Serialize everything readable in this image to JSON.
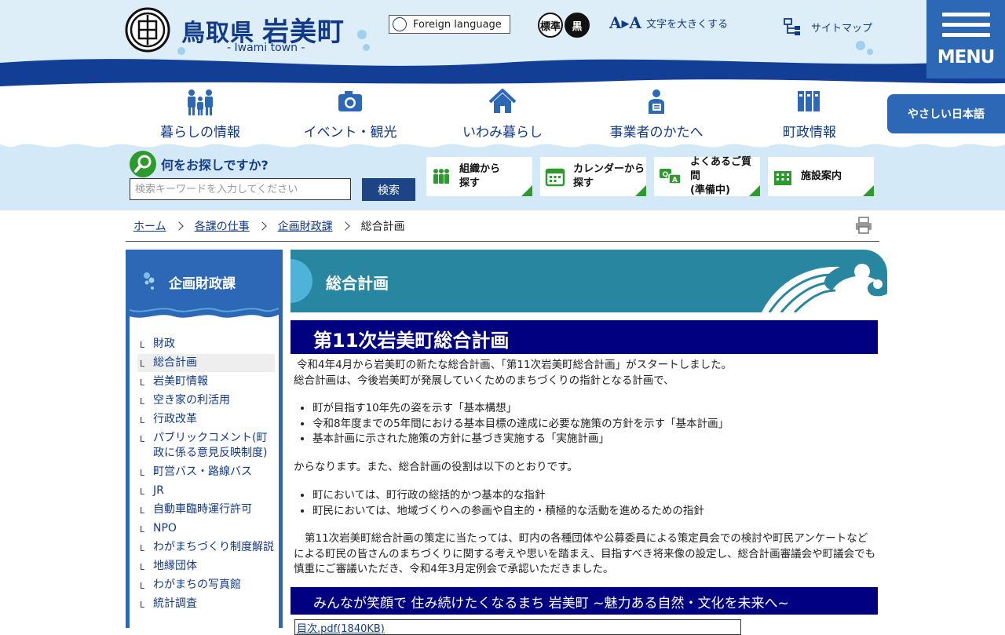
{
  "header": {
    "pref": "鳥取県",
    "town": "岩美町",
    "sub": "- Iwami town -",
    "foreign_label": "Foreign language",
    "contrast_std": "標準",
    "contrast_black": "黒",
    "textsize_glyph": "A▸A",
    "textsize_label": "文字を大きくする",
    "sitemap_label": "サイトマップ",
    "menu_label": "MENU"
  },
  "gnav": [
    {
      "label": "暮らしの情報",
      "icon": "family-icon"
    },
    {
      "label": "イベント・観光",
      "icon": "camera-icon"
    },
    {
      "label": "いわみ暮らし",
      "icon": "house-icon"
    },
    {
      "label": "事業者のかたへ",
      "icon": "business-person-icon"
    },
    {
      "label": "町政情報",
      "icon": "binders-icon"
    }
  ],
  "yasashii_label": "やさしい日本語",
  "search": {
    "title": "何をお探しですか?",
    "placeholder": "検索キーワードを入力してください",
    "button": "検索"
  },
  "quick_links": [
    {
      "label": "組織から\n探す",
      "icon": "people-icon"
    },
    {
      "label": "カレンダーから\n探す",
      "icon": "calendar-icon"
    },
    {
      "label": "よくあるご質問\n(準備中)",
      "icon": "qa-icon"
    },
    {
      "label": "施設案内",
      "icon": "building-icon"
    }
  ],
  "breadcrumb": [
    "ホーム",
    "各課の仕事",
    "企画財政課",
    "総合計画"
  ],
  "side": {
    "title": "企画財政課",
    "items": [
      "財政",
      "総合計画",
      "岩美町情報",
      "空き家の利活用",
      "行政改革",
      "パブリックコメント(町政に係る意見反映制度)",
      "町営バス・路線バス",
      "JR",
      "自動車臨時運行許可",
      "NPO",
      "わがまちづくり制度解説",
      "地縁団体",
      "わがまちの写真館",
      "統計調査"
    ],
    "current_index": 1
  },
  "main": {
    "page_title": "総合計画",
    "h2_1": "第11次岩美町総合計画",
    "p1": "令和4年4月から岩美町の新たな総合計画、「第11次岩美町総合計画」がスタートしました。",
    "p2": "総合計画は、今後岩美町が発展していくためのまちづくりの指針となる計画で、",
    "list1": [
      "町が目指す10年先の姿を示す「基本構想」",
      "令和8年度までの5年間における基本目標の達成に必要な施策の方針を示す「基本計画」",
      "基本計画に示された施策の方針に基づき実施する「実施計画」"
    ],
    "p3": "からなります。また、総合計画の役割は以下のとおりです。",
    "list2": [
      "町においては、町行政の総括的かつ基本的な指針",
      "町民においては、地域づくりへの参画や自主的・積極的な活動を進めるための指針"
    ],
    "p4": "第11次岩美町総合計画の策定に当たっては、町内の各種団体や公募委員による策定員会での検討や町民アンケートなどによる町民の皆さんのまちづくりに関する考えや思いを踏まえ、目指すべき将来像の設定し、総合計画審議会や町議会でも慎重にご審議いただき、令和4年3月定例会で承認いただきました。",
    "h2_2": "みんなが笑顔で 住み続けたくなるまち 岩美町 ~魅力ある自然・文化を未来へ~",
    "pdf_link": "目次.pdf(1840KB)"
  },
  "colors": {
    "navy": "#123a8a",
    "blue": "#2d68b7",
    "teal": "#2886a0",
    "heading": "#000080",
    "green": "#2c9a2c"
  }
}
